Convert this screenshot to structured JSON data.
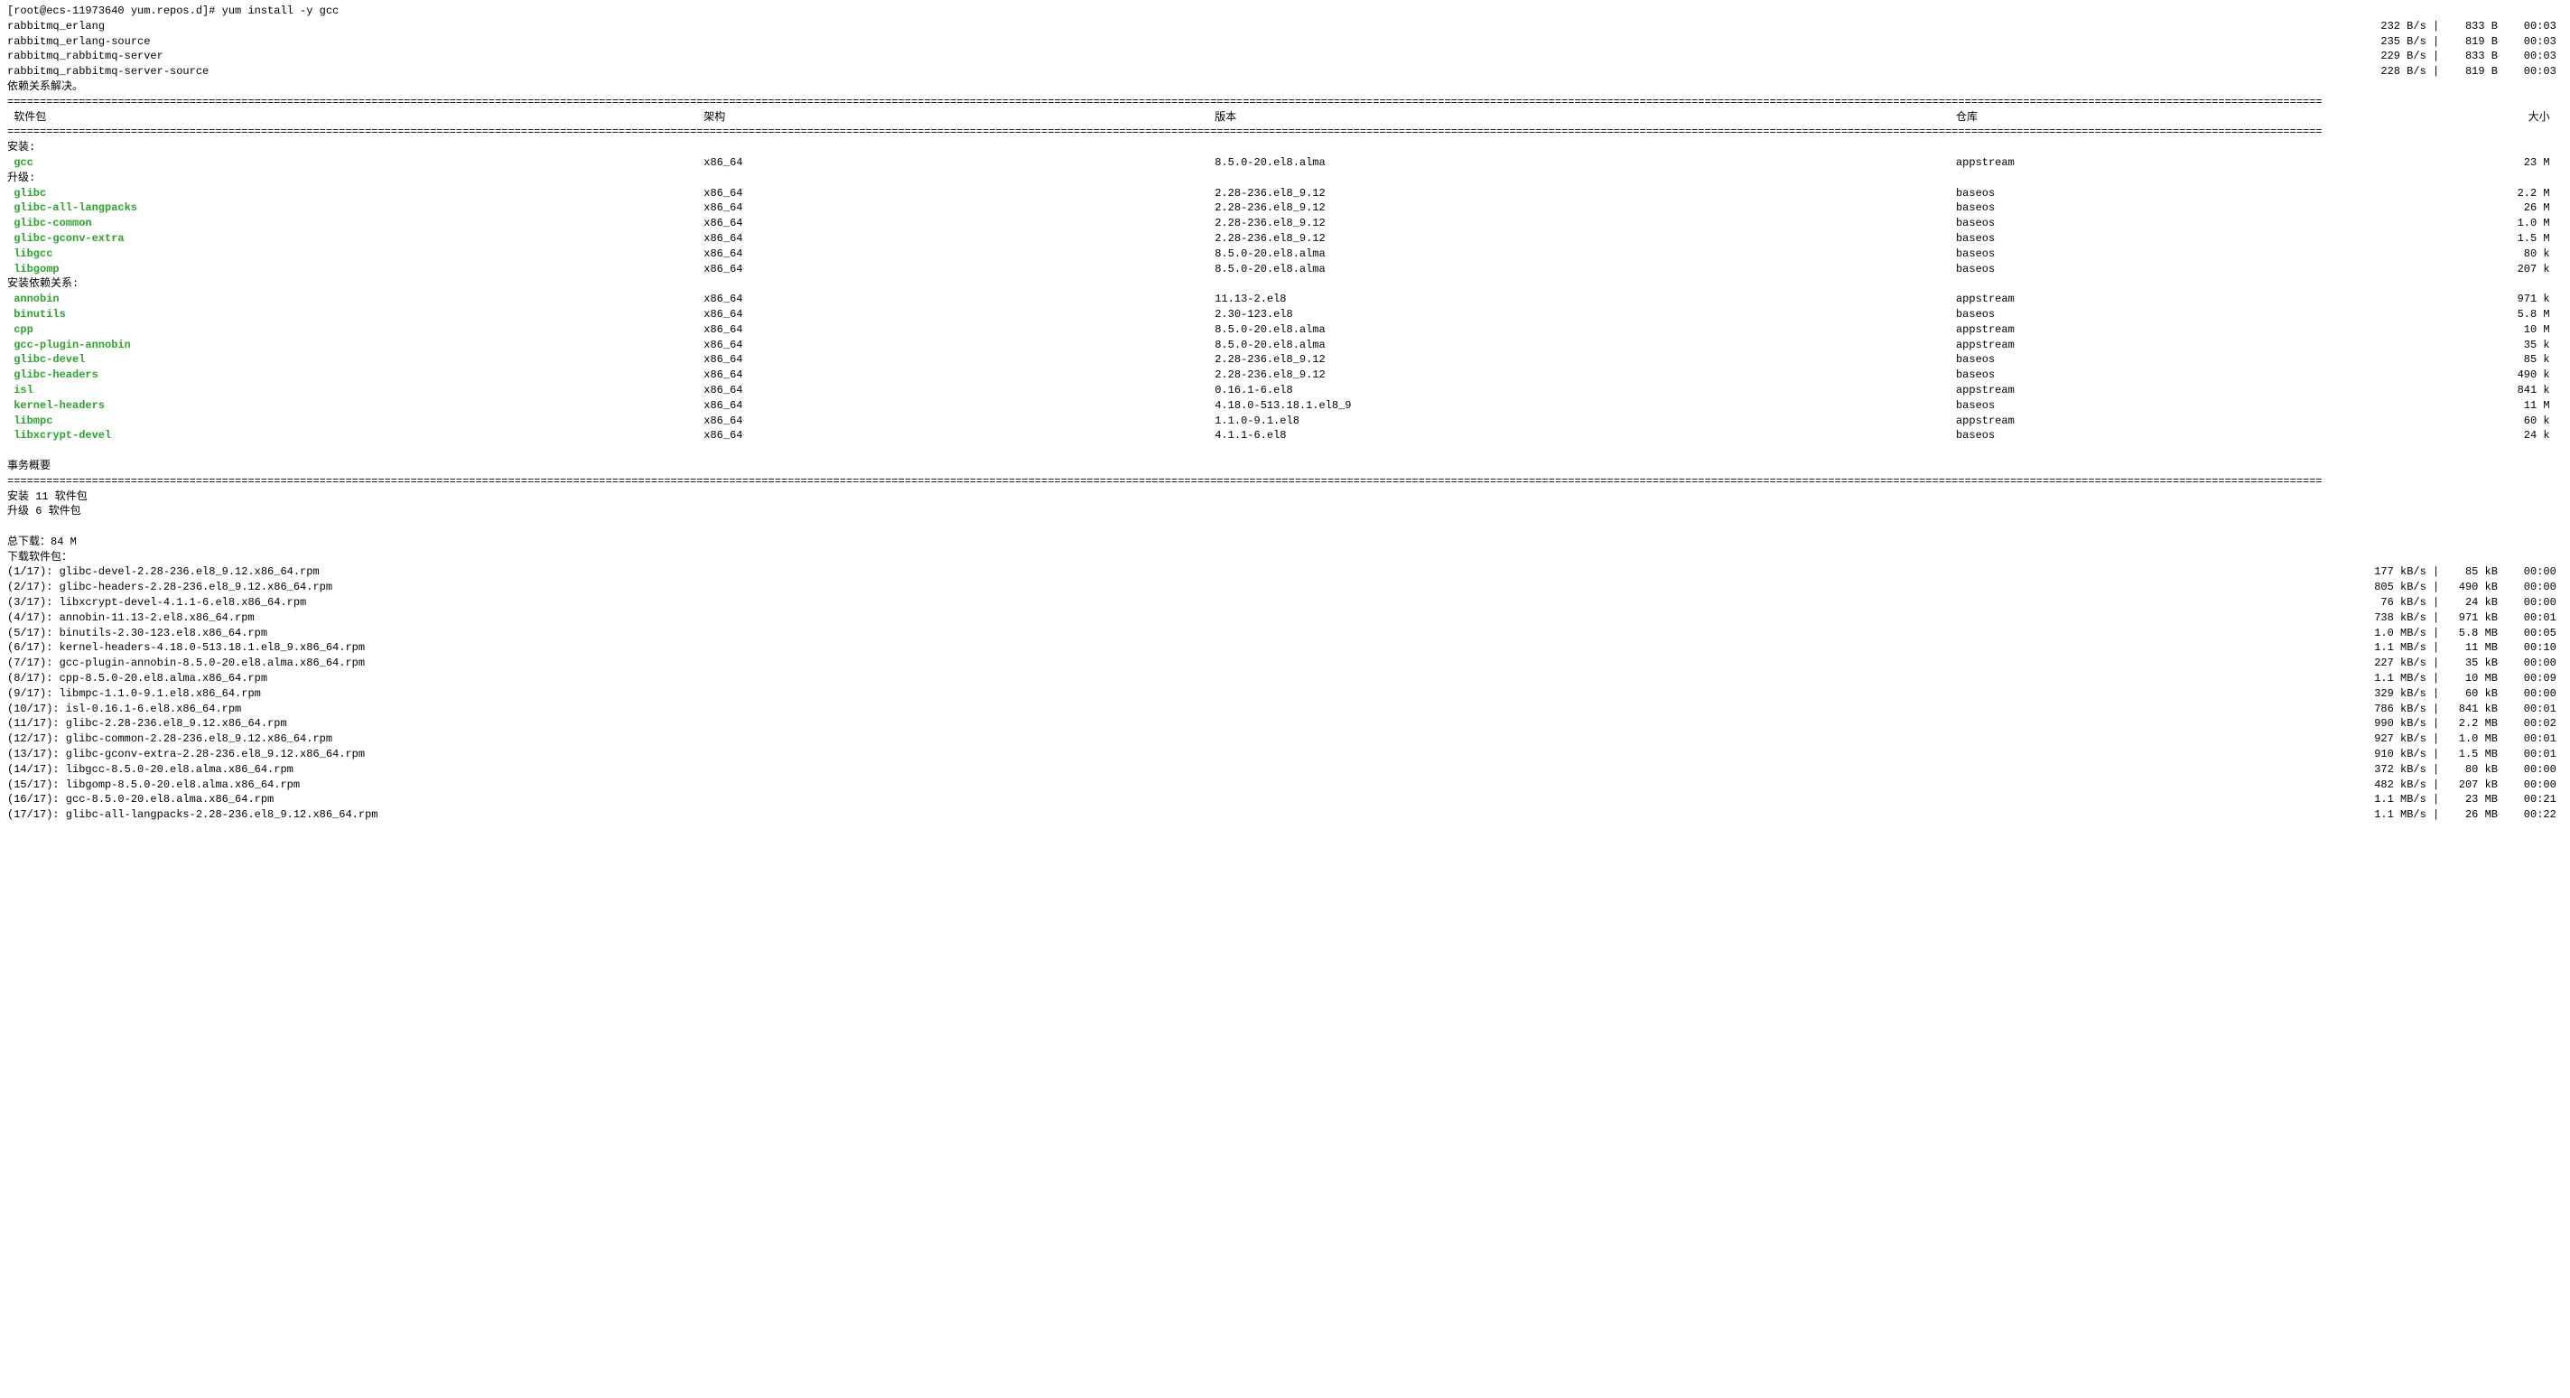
{
  "prompt": "[root@ecs-11973640 yum.repos.d]# yum install -y gcc",
  "repos": [
    {
      "name": "rabbitmq_erlang",
      "speed": "232  B/s",
      "size": "833  B",
      "time": "00:03"
    },
    {
      "name": "rabbitmq_erlang-source",
      "speed": "235  B/s",
      "size": "819  B",
      "time": "00:03"
    },
    {
      "name": "rabbitmq_rabbitmq-server",
      "speed": "229  B/s",
      "size": "833  B",
      "time": "00:03"
    },
    {
      "name": "rabbitmq_rabbitmq-server-source",
      "speed": "228  B/s",
      "size": "819  B",
      "time": "00:03"
    }
  ],
  "resolved_label": "依赖关系解决。",
  "hdr": {
    "pkg": "软件包",
    "arch": "架构",
    "ver": "版本",
    "repo": "仓库",
    "size": "大小"
  },
  "sect_install": "安装:",
  "sect_upgrade": "升级:",
  "sect_deps": "安装依赖关系:",
  "install_rows": [
    {
      "name": "gcc",
      "arch": "x86_64",
      "ver": "8.5.0-20.el8.alma",
      "repo": "appstream",
      "size": "23 M"
    }
  ],
  "upgrade_rows": [
    {
      "name": "glibc",
      "arch": "x86_64",
      "ver": "2.28-236.el8_9.12",
      "repo": "baseos",
      "size": "2.2 M"
    },
    {
      "name": "glibc-all-langpacks",
      "arch": "x86_64",
      "ver": "2.28-236.el8_9.12",
      "repo": "baseos",
      "size": "26 M"
    },
    {
      "name": "glibc-common",
      "arch": "x86_64",
      "ver": "2.28-236.el8_9.12",
      "repo": "baseos",
      "size": "1.0 M"
    },
    {
      "name": "glibc-gconv-extra",
      "arch": "x86_64",
      "ver": "2.28-236.el8_9.12",
      "repo": "baseos",
      "size": "1.5 M"
    },
    {
      "name": "libgcc",
      "arch": "x86_64",
      "ver": "8.5.0-20.el8.alma",
      "repo": "baseos",
      "size": "80 k"
    },
    {
      "name": "libgomp",
      "arch": "x86_64",
      "ver": "8.5.0-20.el8.alma",
      "repo": "baseos",
      "size": "207 k"
    }
  ],
  "dep_rows": [
    {
      "name": "annobin",
      "arch": "x86_64",
      "ver": "11.13-2.el8",
      "repo": "appstream",
      "size": "971 k"
    },
    {
      "name": "binutils",
      "arch": "x86_64",
      "ver": "2.30-123.el8",
      "repo": "baseos",
      "size": "5.8 M"
    },
    {
      "name": "cpp",
      "arch": "x86_64",
      "ver": "8.5.0-20.el8.alma",
      "repo": "appstream",
      "size": "10 M"
    },
    {
      "name": "gcc-plugin-annobin",
      "arch": "x86_64",
      "ver": "8.5.0-20.el8.alma",
      "repo": "appstream",
      "size": "35 k"
    },
    {
      "name": "glibc-devel",
      "arch": "x86_64",
      "ver": "2.28-236.el8_9.12",
      "repo": "baseos",
      "size": "85 k"
    },
    {
      "name": "glibc-headers",
      "arch": "x86_64",
      "ver": "2.28-236.el8_9.12",
      "repo": "baseos",
      "size": "490 k"
    },
    {
      "name": "isl",
      "arch": "x86_64",
      "ver": "0.16.1-6.el8",
      "repo": "appstream",
      "size": "841 k"
    },
    {
      "name": "kernel-headers",
      "arch": "x86_64",
      "ver": "4.18.0-513.18.1.el8_9",
      "repo": "baseos",
      "size": "11 M"
    },
    {
      "name": "libmpc",
      "arch": "x86_64",
      "ver": "1.1.0-9.1.el8",
      "repo": "appstream",
      "size": "60 k"
    },
    {
      "name": "libxcrypt-devel",
      "arch": "x86_64",
      "ver": "4.1.1-6.el8",
      "repo": "baseos",
      "size": "24 k"
    }
  ],
  "summary_label": "事务概要",
  "summary_install": "安装  11 软件包",
  "summary_upgrade": "升级   6 软件包",
  "total_download": "总下载：84 M",
  "downloading_label": "下载软件包：",
  "downloads": [
    {
      "left": "(1/17): glibc-devel-2.28-236.el8_9.12.x86_64.rpm",
      "speed": "177 kB/s",
      "size": "85 kB",
      "time": "00:00"
    },
    {
      "left": "(2/17): glibc-headers-2.28-236.el8_9.12.x86_64.rpm",
      "speed": "805 kB/s",
      "size": "490 kB",
      "time": "00:00"
    },
    {
      "left": "(3/17): libxcrypt-devel-4.1.1-6.el8.x86_64.rpm",
      "speed": "76 kB/s",
      "size": "24 kB",
      "time": "00:00"
    },
    {
      "left": "(4/17): annobin-11.13-2.el8.x86_64.rpm",
      "speed": "738 kB/s",
      "size": "971 kB",
      "time": "00:01"
    },
    {
      "left": "(5/17): binutils-2.30-123.el8.x86_64.rpm",
      "speed": "1.0 MB/s",
      "size": "5.8 MB",
      "time": "00:05"
    },
    {
      "left": "(6/17): kernel-headers-4.18.0-513.18.1.el8_9.x86_64.rpm",
      "speed": "1.1 MB/s",
      "size": "11 MB",
      "time": "00:10"
    },
    {
      "left": "(7/17): gcc-plugin-annobin-8.5.0-20.el8.alma.x86_64.rpm",
      "speed": "227 kB/s",
      "size": "35 kB",
      "time": "00:00"
    },
    {
      "left": "(8/17): cpp-8.5.0-20.el8.alma.x86_64.rpm",
      "speed": "1.1 MB/s",
      "size": "10 MB",
      "time": "00:09"
    },
    {
      "left": "(9/17): libmpc-1.1.0-9.1.el8.x86_64.rpm",
      "speed": "329 kB/s",
      "size": "60 kB",
      "time": "00:00"
    },
    {
      "left": "(10/17): isl-0.16.1-6.el8.x86_64.rpm",
      "speed": "786 kB/s",
      "size": "841 kB",
      "time": "00:01"
    },
    {
      "left": "(11/17): glibc-2.28-236.el8_9.12.x86_64.rpm",
      "speed": "990 kB/s",
      "size": "2.2 MB",
      "time": "00:02"
    },
    {
      "left": "(12/17): glibc-common-2.28-236.el8_9.12.x86_64.rpm",
      "speed": "927 kB/s",
      "size": "1.0 MB",
      "time": "00:01"
    },
    {
      "left": "(13/17): glibc-gconv-extra-2.28-236.el8_9.12.x86_64.rpm",
      "speed": "910 kB/s",
      "size": "1.5 MB",
      "time": "00:01"
    },
    {
      "left": "(14/17): libgcc-8.5.0-20.el8.alma.x86_64.rpm",
      "speed": "372 kB/s",
      "size": "80 kB",
      "time": "00:00"
    },
    {
      "left": "(15/17): libgomp-8.5.0-20.el8.alma.x86_64.rpm",
      "speed": "482 kB/s",
      "size": "207 kB",
      "time": "00:00"
    },
    {
      "left": "(16/17): gcc-8.5.0-20.el8.alma.x86_64.rpm",
      "speed": "1.1 MB/s",
      "size": "23 MB",
      "time": "00:21"
    },
    {
      "left": "(17/17): glibc-all-langpacks-2.28-236.el8_9.12.x86_64.rpm",
      "speed": "1.1 MB/s",
      "size": "26 MB",
      "time": "00:22"
    }
  ]
}
